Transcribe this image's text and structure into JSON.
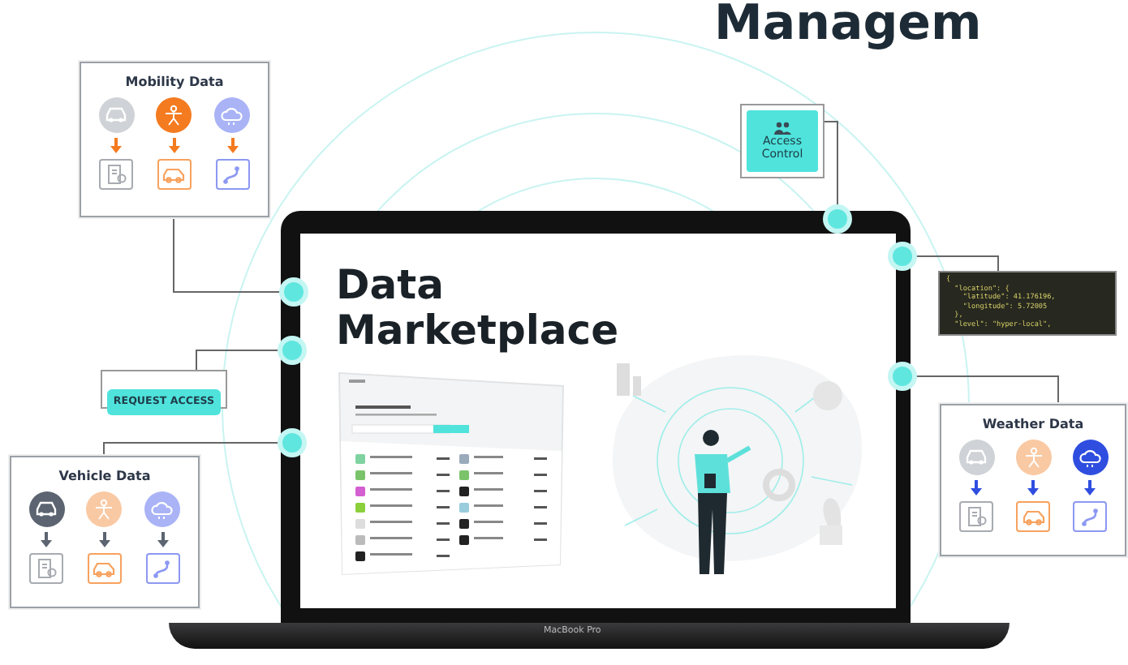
{
  "heading": "Managem",
  "mobility_card": {
    "title": "Mobility Data",
    "sources": [
      {
        "kind": "car",
        "selected": false
      },
      {
        "kind": "person",
        "selected": true
      },
      {
        "kind": "cloud",
        "selected": false
      }
    ]
  },
  "access_control": {
    "label": "Access Control"
  },
  "laptop": {
    "screen_title": "Data Marketplace",
    "model": "MacBook Pro"
  },
  "json_snippet": {
    "lines": [
      "{",
      "  \"location\": {",
      "    \"latitude\": 41.176196,",
      "    \"longitude\": 5.72005",
      "  },",
      "  \"level\": \"hyper-local\","
    ]
  },
  "request_access": {
    "label": "REQUEST ACCESS"
  },
  "vehicle_card": {
    "title": "Vehicle Data",
    "sources": [
      {
        "kind": "car",
        "selected": true
      },
      {
        "kind": "person",
        "selected": false
      },
      {
        "kind": "cloud",
        "selected": false
      }
    ]
  },
  "weather_card": {
    "title": "Weather Data",
    "sources": [
      {
        "kind": "car",
        "selected": false
      },
      {
        "kind": "person",
        "selected": false
      },
      {
        "kind": "cloud",
        "selected": true
      }
    ]
  }
}
